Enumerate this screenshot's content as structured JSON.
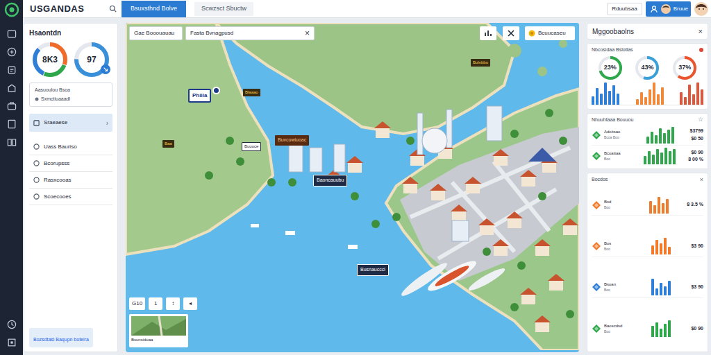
{
  "app": {
    "logo": "USGANDAS"
  },
  "top_tabs": [
    {
      "label": "Bsuxsthnd Bolve",
      "selected": true
    },
    {
      "label": "Scwzsct Sbuctw",
      "selected": false
    }
  ],
  "top_right": {
    "button": "Rduubsaa",
    "user_button": "Bruue"
  },
  "left_panel": {
    "title": "Hsaontdn",
    "gauges": [
      {
        "label": "8K3",
        "segments": [
          {
            "level": 0.3,
            "color": "#f06a2a"
          },
          {
            "level": 0.25,
            "color": "#2ea84a"
          },
          {
            "level": 0.3,
            "color": "#2f7fd6"
          }
        ]
      },
      {
        "label": "97",
        "segments": [
          {
            "level": 0.75,
            "color": "#3a8fd9"
          }
        ]
      }
    ],
    "card": {
      "title": "Aasuoulou Bsoa",
      "subtitle": "Sxmctiuaaadl"
    },
    "nav": [
      {
        "label": "Sraeaese",
        "selected": true,
        "chevron": "›"
      },
      {
        "label": "Uass Bauriso",
        "selected": false,
        "chevron": ""
      },
      {
        "label": "Bcorupsss",
        "selected": false,
        "chevron": ""
      },
      {
        "label": "Rasxcooas",
        "selected": false,
        "chevron": ""
      },
      {
        "label": "Scoecooes",
        "selected": false,
        "chevron": ""
      }
    ],
    "footer": "Bozsdtasl Baqupn boteira"
  },
  "map": {
    "fields": [
      {
        "value": "Gae Booouauau",
        "clear": ""
      },
      {
        "value": "Fasta Bvnagpusd",
        "clear": "×"
      }
    ],
    "button": "Bcuucaseu",
    "labels": [
      {
        "text": "Phiiia",
        "kind": "highlight"
      },
      {
        "text": "Blaaao",
        "kind": "yellow"
      },
      {
        "text": "Bulnbbo",
        "kind": "yellow"
      },
      {
        "text": "Baa",
        "kind": "yellow"
      },
      {
        "text": "Buuoce",
        "kind": "plain"
      },
      {
        "text": "Buvcowiuoac",
        "kind": "brown"
      },
      {
        "text": "Baoncauubu",
        "kind": "navy"
      },
      {
        "text": "Busnaucccl",
        "kind": "navy"
      }
    ],
    "zoom": [
      "G10",
      "1",
      "↕",
      "◂"
    ],
    "minimap": "Bsunsiduaa"
  },
  "right_panel": {
    "title": "Mggoobaolns",
    "close": "×",
    "summary": {
      "title": "Nbcosidaa Bslotlas",
      "alert": true,
      "gauges": [
        {
          "label": "23%",
          "level": 0.7,
          "color": "#2ea84a"
        },
        {
          "label": "43%",
          "level": 0.55,
          "color": "#3aa0d8"
        },
        {
          "label": "37%",
          "level": 0.6,
          "color": "#e9552d"
        }
      ],
      "series": [
        {
          "values": [
            3,
            6,
            4,
            8,
            5,
            7,
            4
          ],
          "color": "#2f7fd6"
        },
        {
          "values": [
            2,
            5,
            3,
            6,
            9,
            4,
            7
          ],
          "color": "#f08a3a"
        },
        {
          "values": [
            5,
            3,
            8,
            4,
            9,
            6
          ],
          "color": "#e2553a"
        }
      ]
    },
    "sections": [
      {
        "title": "Nhuuhtaaa Bouuou",
        "action": "☆",
        "rows": [
          {
            "label": "Adoitsao",
            "sub": "Bcoa Boo",
            "values": [
              "$3799",
              "$0 50"
            ],
            "bars": [
              4,
              7,
              5,
              9,
              6,
              8,
              10
            ],
            "color": "#2ea84a"
          },
          {
            "label": "Bcoattaa",
            "sub": "Boo",
            "values": [
              "$0 90",
              "8 00 %"
            ],
            "bars": [
              5,
              8,
              6,
              9,
              7,
              10,
              8,
              9
            ],
            "color": "#2ea84a"
          }
        ]
      },
      {
        "title": "Bocdos",
        "action": "×",
        "rows": [
          {
            "label": "Bsd",
            "sub": "Boo",
            "values": [
              "8 3.5 %"
            ],
            "bars": [
              6,
              4,
              8,
              5,
              7
            ],
            "color": "#f07b2a"
          },
          {
            "label": "Bos",
            "sub": "Boo",
            "values": [
              "$3 90"
            ],
            "bars": [
              5,
              8,
              6,
              9,
              4
            ],
            "color": "#f07b2a"
          },
          {
            "label": "Bsoan",
            "sub": "Boo",
            "values": [
              "$3 90"
            ],
            "bars": [
              9,
              4,
              7,
              5,
              8
            ],
            "color": "#2f7fd6"
          },
          {
            "label": "Baoscdsd",
            "sub": "Boo",
            "values": [
              "$0 90"
            ],
            "bars": [
              7,
              9,
              5,
              8,
              10
            ],
            "color": "#2ea84a"
          }
        ]
      }
    ]
  }
}
